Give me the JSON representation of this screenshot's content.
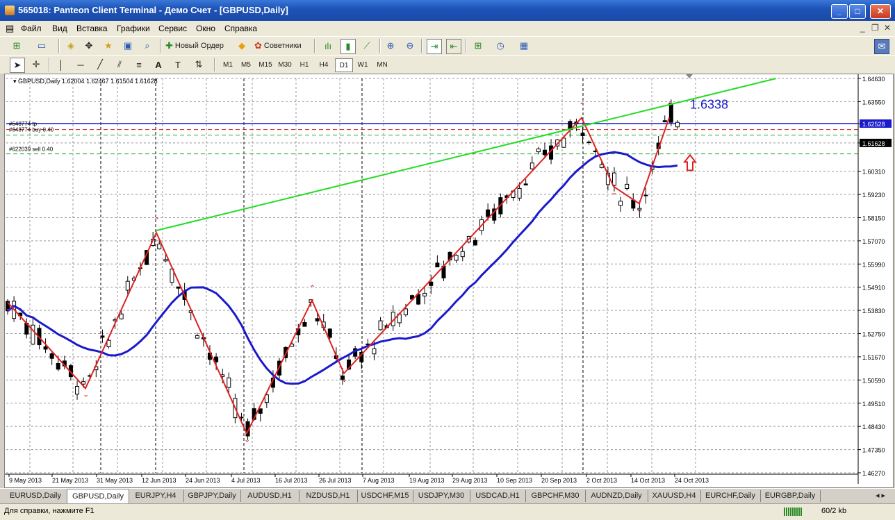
{
  "window": {
    "title": "565018: Panteon Client Terminal - Демо Счет - [GBPUSD,Daily]",
    "minimize": "_",
    "maximize": "□",
    "close": "✕"
  },
  "menu": [
    "Файл",
    "Вид",
    "Вставка",
    "Графики",
    "Сервис",
    "Окно",
    "Справка"
  ],
  "mdi": {
    "minimize": "_",
    "restore": "❐",
    "close": "✕"
  },
  "toolbar1": {
    "new_order": "Новый Ордер",
    "experts": "Советники"
  },
  "timeframes": [
    "M1",
    "M5",
    "M15",
    "M30",
    "H1",
    "H4",
    "D1",
    "W1",
    "MN"
  ],
  "active_timeframe": "D1",
  "chart": {
    "header": "GBPUSD,Daily  1.62004 1.62467 1.61504 1.61628",
    "level_labels": [
      "#648774 tp",
      "#648774 buy 0.40",
      "#622039 sell 0.40"
    ],
    "annotation": "1.6338",
    "price_ticks": [
      "1.64630",
      "1.63550",
      "1.62528",
      "1.61628",
      "1.60310",
      "1.59230",
      "1.58150",
      "1.57070",
      "1.55990",
      "1.54910",
      "1.53830",
      "1.52750",
      "1.51670",
      "1.50590",
      "1.49510",
      "1.48430",
      "1.47350",
      "1.46270"
    ],
    "highlight_price": "1.62528",
    "current_price": "1.61628",
    "date_ticks": [
      "9 May 2013",
      "21 May 2013",
      "31 May 2013",
      "12 Jun 2013",
      "24 Jun 2013",
      "4 Jul 2013",
      "16 Jul 2013",
      "26 Jul 2013",
      "7 Aug 2013",
      "19 Aug 2013",
      "29 Aug 2013",
      "10 Sep 2013",
      "20 Sep 2013",
      "2 Oct 2013",
      "14 Oct 2013",
      "24 Oct 2013"
    ],
    "colors": {
      "trendline": "#22dd22",
      "zigzag": "#dd2222",
      "ma": "#1a1acc",
      "level": "#1a1acc",
      "arrow": "#dd2222"
    }
  },
  "chart_data": {
    "type": "candlestick",
    "symbol": "GBPUSD",
    "timeframe": "Daily",
    "ylim": [
      1.4627,
      1.6463
    ],
    "ohlc_last": {
      "open": 1.62004,
      "high": 1.62467,
      "low": 1.61504,
      "close": 1.61628
    },
    "levels": {
      "tp": 1.62528,
      "buy": 1.6225,
      "sell": 1.6112
    },
    "zigzag_pivots": [
      1.542,
      1.502,
      1.5745,
      1.481,
      1.543,
      1.509,
      1.628,
      1.596,
      1.588,
      1.628
    ],
    "target": 1.6338
  },
  "tabs": [
    "EURUSD,Daily",
    "GBPUSD,Daily",
    "EURJPY,H4",
    "GBPJPY,Daily",
    "AUDUSD,H1",
    "NZDUSD,H1",
    "USDCHF,M15",
    "USDJPY,M30",
    "USDCAD,H1",
    "GBPCHF,M30",
    "AUDNZD,Daily",
    "XAUUSD,H4",
    "EURCHF,Daily",
    "EURGBP,Daily"
  ],
  "active_tab": "GBPUSD,Daily",
  "status": {
    "help": "Для справки, нажмите F1",
    "traffic": "60/2 kb"
  }
}
